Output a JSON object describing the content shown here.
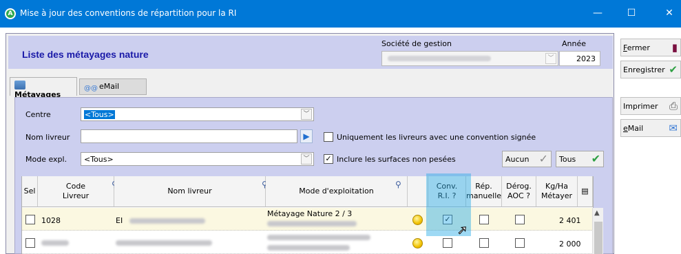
{
  "window": {
    "title": "Mise à jour des conventions de répartition pour la RI",
    "app_icon": "A",
    "minimize": "—",
    "maximize": "☐",
    "close": "✕"
  },
  "header": {
    "page_title": "Liste des métayages nature",
    "societe_label": "Société de gestion",
    "annee_label": "Année",
    "annee_value": "2023"
  },
  "side_buttons": {
    "fermer": {
      "first": "F",
      "rest": "ermer"
    },
    "enregistrer": "Enregistrer",
    "imprimer": "Imprimer",
    "email": {
      "first": "e",
      "rest": "Mail"
    }
  },
  "tabs": [
    {
      "label": "Métayages"
    },
    {
      "label": "eMail"
    }
  ],
  "filters": {
    "centre_label": "Centre",
    "centre_value": "<Tous>",
    "nom_livreur_label": "Nom livreur",
    "nom_livreur_value": "",
    "mode_label": "Mode expl.",
    "mode_value": "<Tous>",
    "only_signed_label": "Uniquement les livreurs avec une convention signée",
    "only_signed_checked": false,
    "include_unweighed_label": "Inclure les surfaces non pesées",
    "include_unweighed_checked": true,
    "aucun_label": "Aucun",
    "tous_label": "Tous"
  },
  "grid": {
    "columns": {
      "sel": "Sel",
      "code_livreur": "Code\nLivreur",
      "nom_livreur": "Nom livreur",
      "mode_exploitation": "Mode d'exploitation",
      "conv_ri": "Conv.\nR.I. ?",
      "rep_manuelle": "Rép.\nmanuelle",
      "derog_aoc": "Dérog.\nAOC ?",
      "kg_ha": "Kg/Ha\nMétayer"
    },
    "rows": [
      {
        "code": "1028",
        "nom_prefix": "EI",
        "mode": "Métayage Nature 2 / 3",
        "conv_ri": true,
        "rep": false,
        "derog": false,
        "kg_ha": "2 401"
      },
      {
        "code": "",
        "nom_prefix": "",
        "mode": "",
        "conv_ri": false,
        "rep": false,
        "derog": false,
        "kg_ha": "2 000"
      }
    ]
  },
  "colors": {
    "titlebar": "#0078d7",
    "panel": "#cccfef",
    "row_highlight": "#fbf8e1",
    "page_title": "#1a1aa8"
  }
}
